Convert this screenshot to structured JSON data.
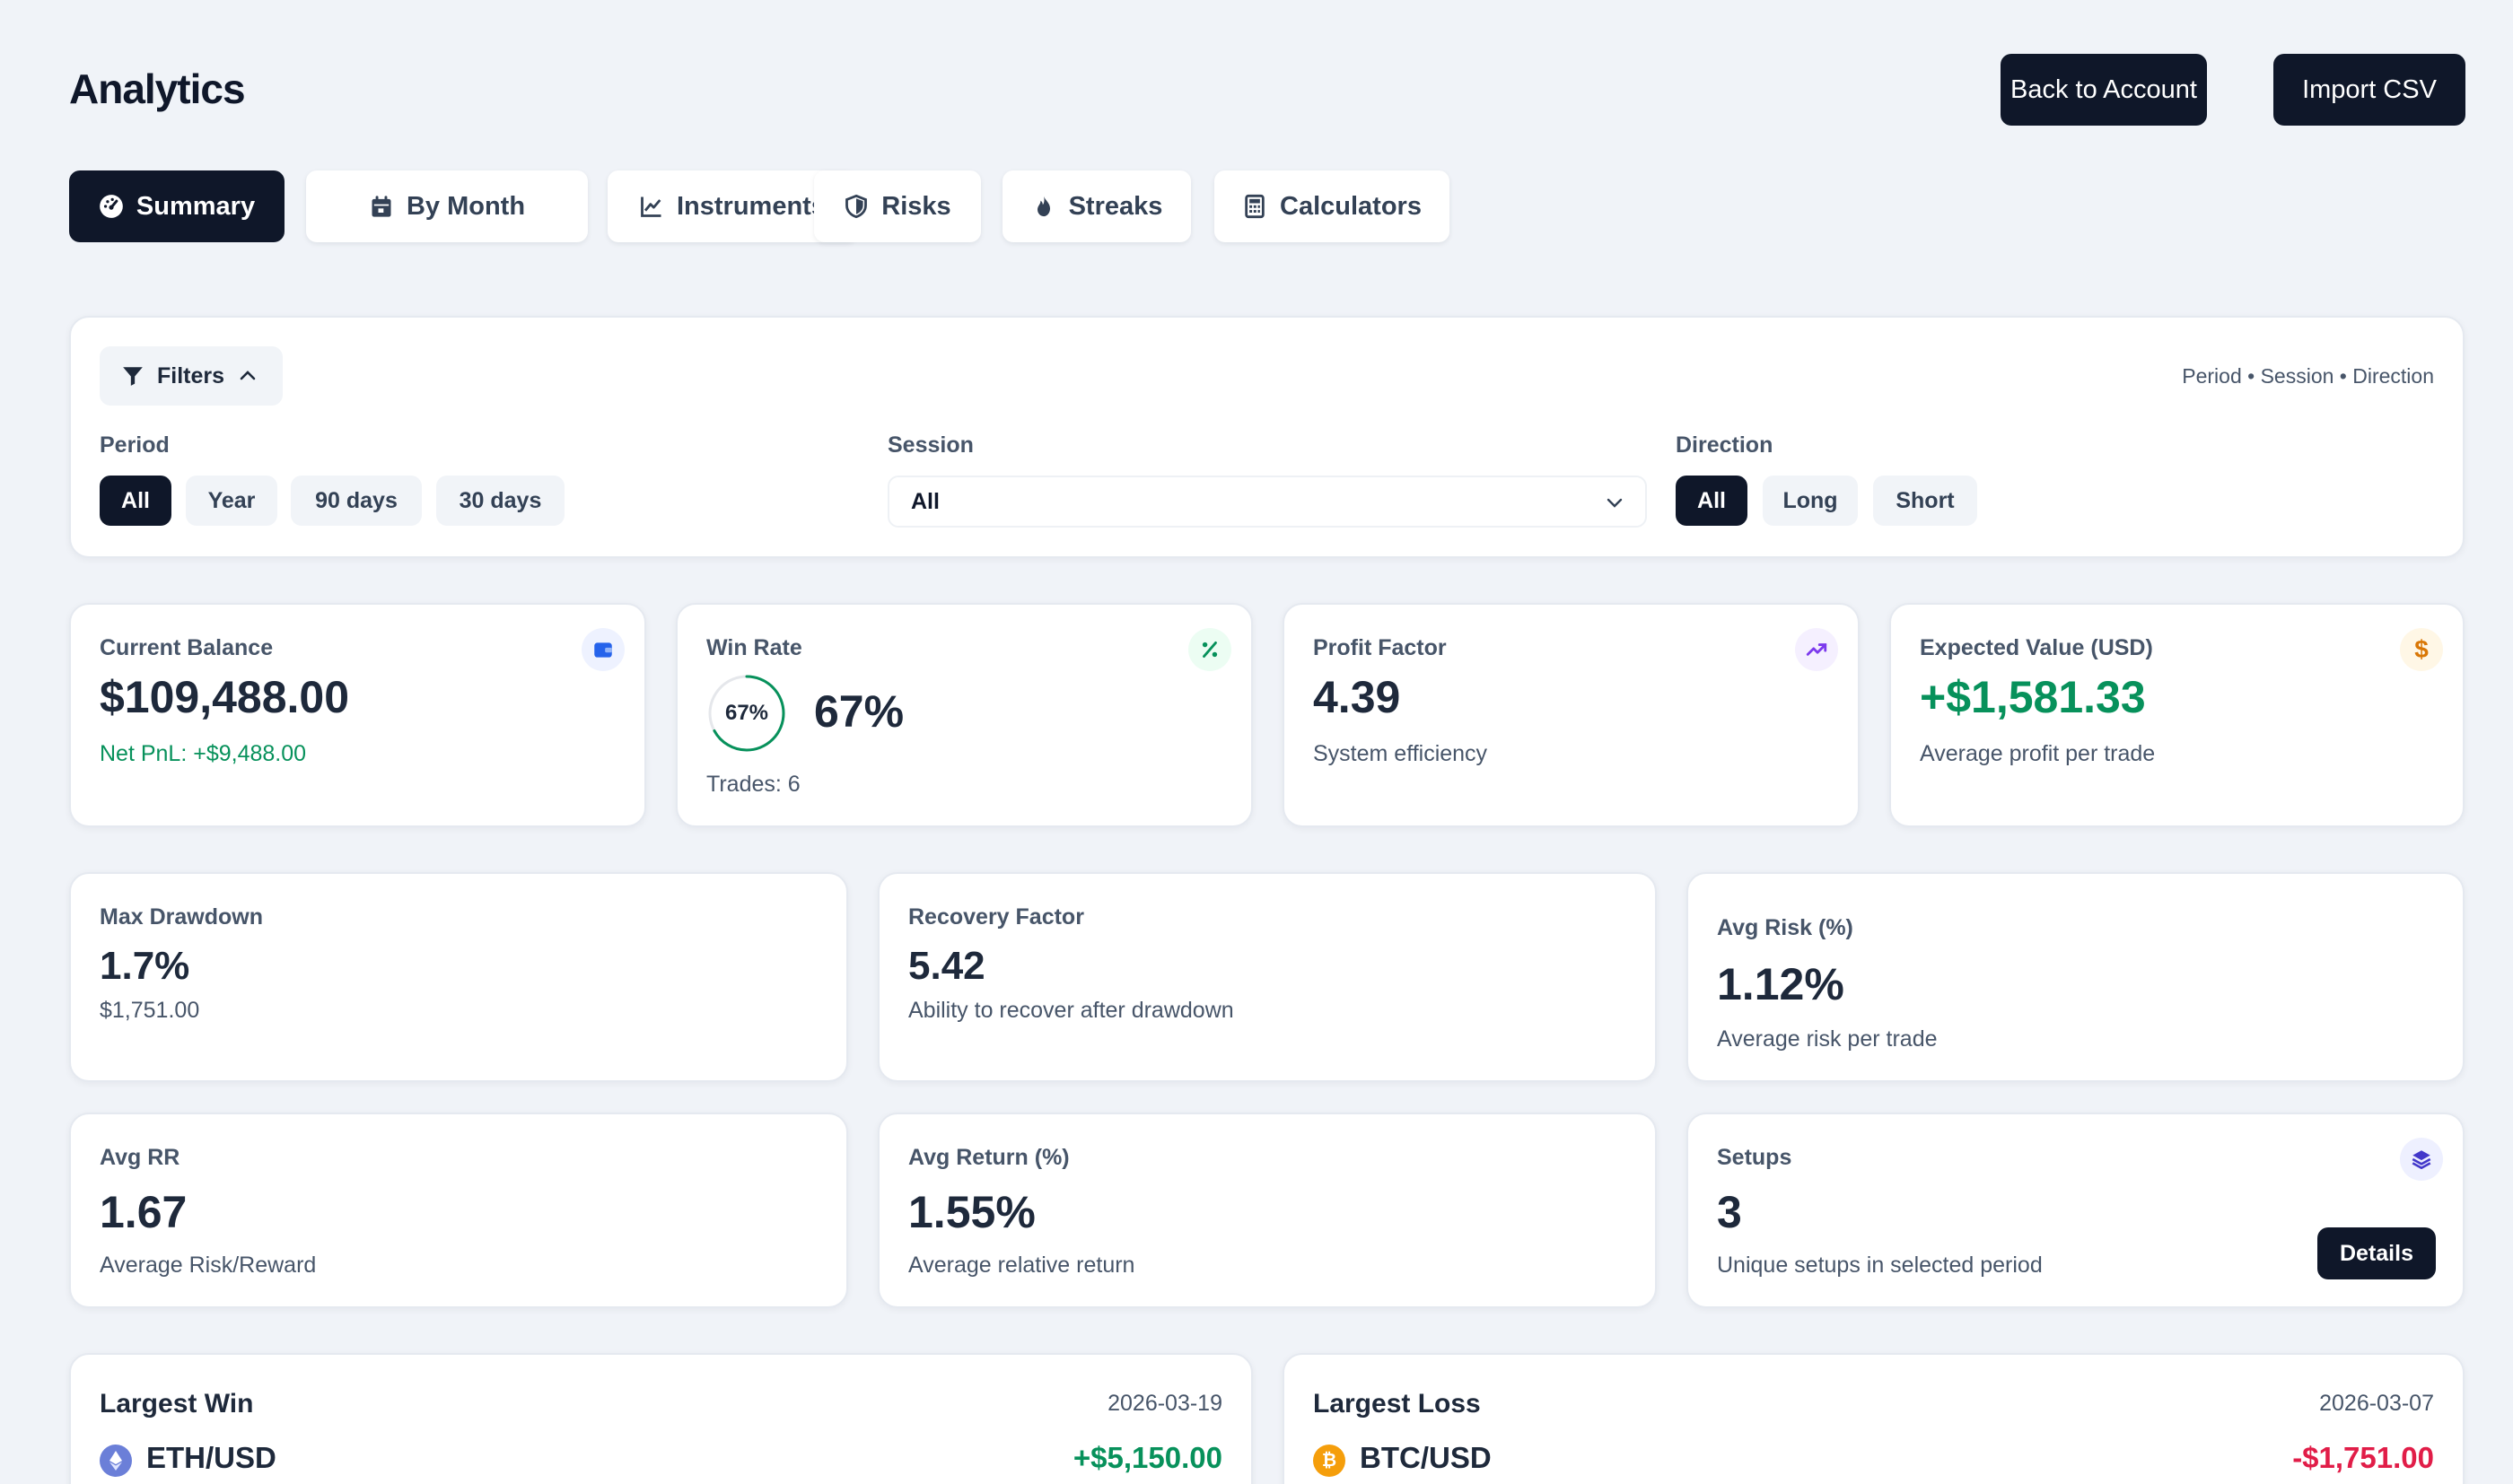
{
  "header": {
    "title": "Analytics",
    "back_label": "Back to Account",
    "import_label": "Import CSV"
  },
  "tabs": [
    {
      "label": "Summary",
      "icon": "dashboard-icon",
      "active": true
    },
    {
      "label": "By Month",
      "icon": "calendar-icon",
      "active": false
    },
    {
      "label": "Instruments",
      "icon": "line-chart-icon",
      "active": false
    },
    {
      "label": "Risks",
      "icon": "shield-icon",
      "active": false
    },
    {
      "label": "Streaks",
      "icon": "flame-icon",
      "active": false
    },
    {
      "label": "Calculators",
      "icon": "calculator-icon",
      "active": false
    }
  ],
  "filters": {
    "toggle_label": "Filters",
    "summary": "Period • Session • Direction",
    "period": {
      "label": "Period",
      "options": [
        "All",
        "Year",
        "90 days",
        "30 days"
      ],
      "selected": "All"
    },
    "session": {
      "label": "Session",
      "value": "All"
    },
    "direction": {
      "label": "Direction",
      "options": [
        "All",
        "Long",
        "Short"
      ],
      "selected": "All"
    }
  },
  "stats": {
    "balance": {
      "label": "Current Balance",
      "value": "$109,488.00",
      "sub": "Net PnL: +$9,488.00",
      "icon": "wallet-icon"
    },
    "win_rate": {
      "label": "Win Rate",
      "value": "67%",
      "ring_label": "67%",
      "ring_fraction": 0.67,
      "sub": "Trades: 6",
      "icon": "percent-icon"
    },
    "profit_factor": {
      "label": "Profit Factor",
      "value": "4.39",
      "sub": "System efficiency",
      "icon": "trending-up-icon"
    },
    "expected_value": {
      "label": "Expected Value (USD)",
      "value": "+$1,581.33",
      "sub": "Average profit per trade",
      "icon": "dollar-icon"
    },
    "max_drawdown": {
      "label": "Max Drawdown",
      "value": "1.7%",
      "sub": "$1,751.00"
    },
    "recovery_factor": {
      "label": "Recovery Factor",
      "value": "5.42",
      "sub": "Ability to recover after drawdown"
    },
    "avg_risk": {
      "label": "Avg Risk (%)",
      "value": "1.12%",
      "sub": "Average risk per trade"
    },
    "avg_rr": {
      "label": "Avg RR",
      "value": "1.67",
      "sub": "Average Risk/Reward"
    },
    "avg_return": {
      "label": "Avg Return (%)",
      "value": "1.55%",
      "sub": "Average relative return"
    },
    "setups": {
      "label": "Setups",
      "value": "3",
      "sub": "Unique setups in selected period",
      "details_label": "Details",
      "icon": "layers-icon"
    }
  },
  "largest_win": {
    "title": "Largest Win",
    "date": "2026-03-19",
    "pair": "ETH/USD",
    "amount": "+$5,150.00",
    "coin_icon": "ethereum-icon"
  },
  "largest_loss": {
    "title": "Largest Loss",
    "date": "2026-03-07",
    "pair": "BTC/USD",
    "amount": "-$1,751.00",
    "coin_icon": "bitcoin-icon"
  },
  "colors": {
    "primary": "#0f1729",
    "positive": "#07915b",
    "negative": "#e11d48",
    "background": "#f0f3f8"
  }
}
